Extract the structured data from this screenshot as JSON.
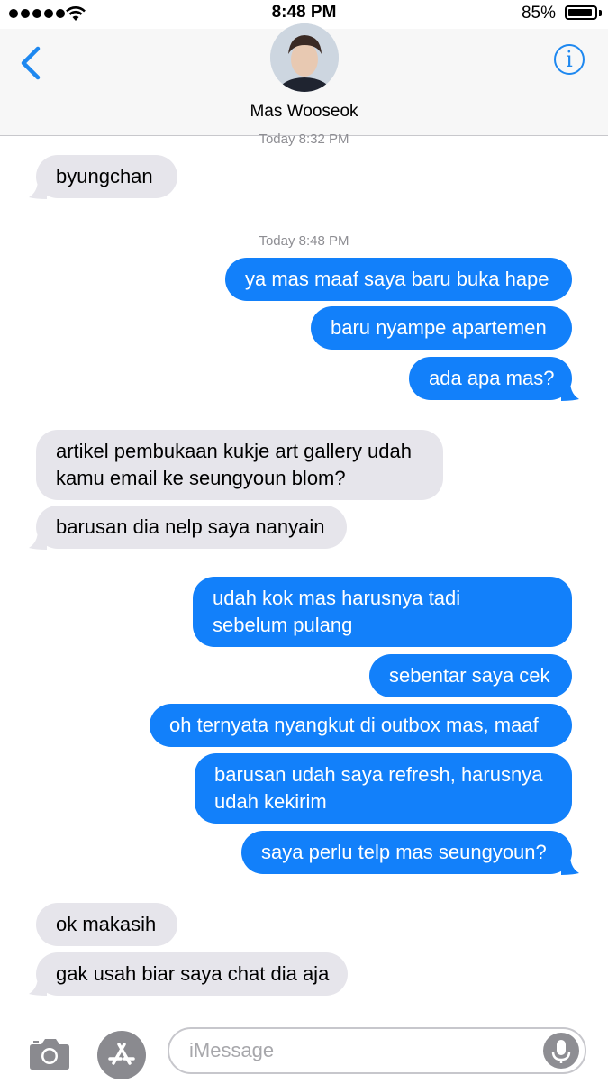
{
  "status_bar": {
    "time": "8:48 PM",
    "battery": "85%",
    "battery_level": 0.85
  },
  "header": {
    "contact_name": "Mas Wooseok"
  },
  "thread": {
    "stamp1": "Today 8:32 PM",
    "stamp2": "Today 8:48 PM",
    "messages": [
      {
        "from": "contact",
        "text": "byungchan"
      },
      {
        "from": "me",
        "text": "ya mas maaf saya baru buka hape"
      },
      {
        "from": "me",
        "text": "baru nyampe apartemen"
      },
      {
        "from": "me",
        "text": "ada apa mas?"
      },
      {
        "from": "contact",
        "line1": "artikel pembukaan kukje art gallery udah",
        "line2": "kamu email ke seungyoun blom?"
      },
      {
        "from": "contact",
        "text": "barusan dia nelp saya nanyain"
      },
      {
        "from": "me",
        "line1": "udah kok mas harusnya tadi",
        "line2": "sebelum pulang"
      },
      {
        "from": "me",
        "text": "sebentar saya cek"
      },
      {
        "from": "me",
        "text": "oh ternyata nyangkut di outbox mas, maaf"
      },
      {
        "from": "me",
        "line1": "barusan udah saya refresh, harusnya",
        "line2": "udah kekirim"
      },
      {
        "from": "me",
        "text": "saya perlu telp mas seungyoun?"
      },
      {
        "from": "contact",
        "text": "ok makasih"
      },
      {
        "from": "contact",
        "text": "gak usah biar saya chat dia aja"
      }
    ]
  },
  "composer": {
    "placeholder": "iMessage"
  },
  "colors": {
    "accent": "#1e88f0",
    "outgoing": "#1280fa",
    "incoming": "#e6e5eb"
  }
}
